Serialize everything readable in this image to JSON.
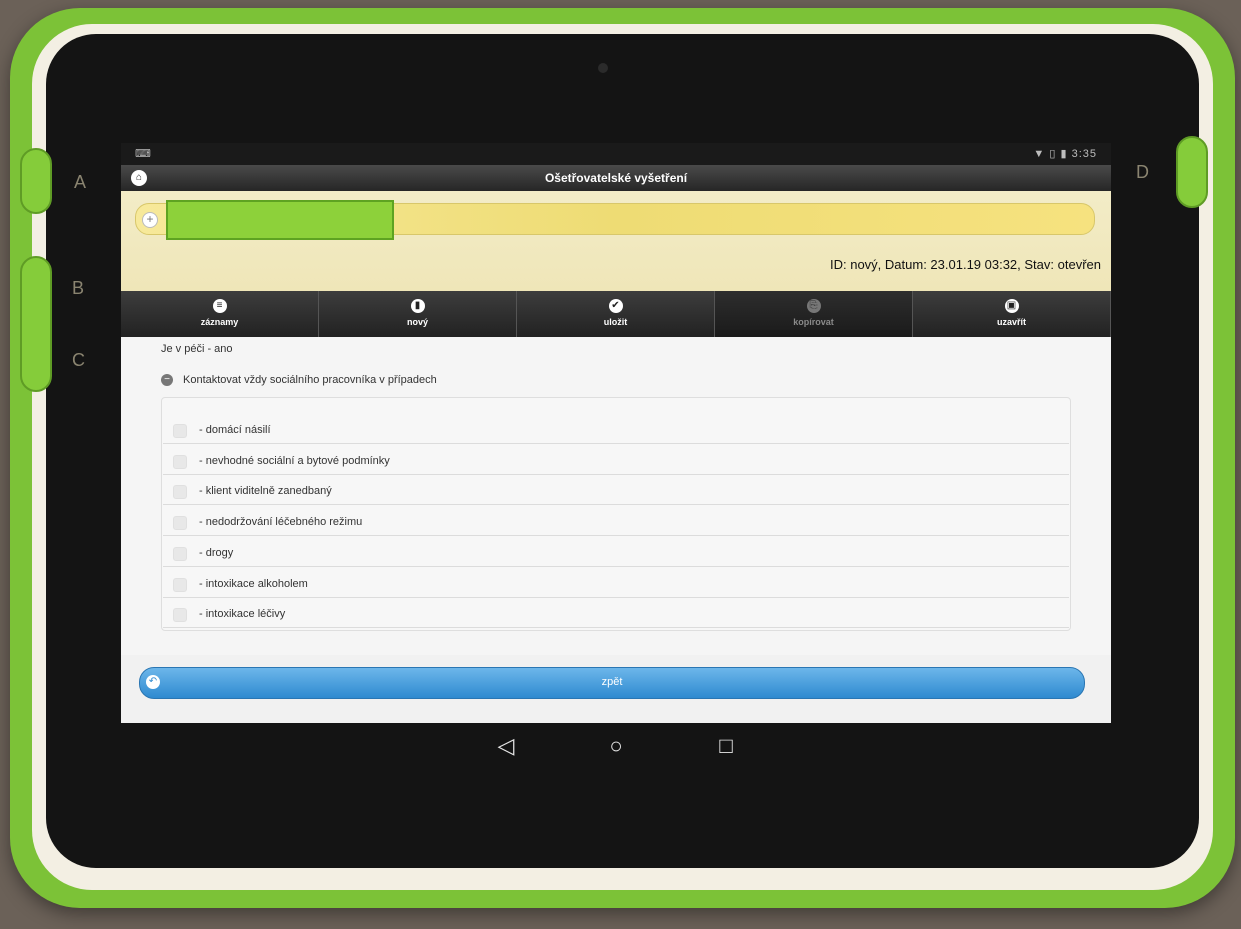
{
  "statusbar": {
    "left_icon": "keyboard-icon",
    "time": "3:35",
    "indicators": "▼ ▯ ▮"
  },
  "titlebar": {
    "title": "Ošetřovatelské vyšetření",
    "home_icon": "home-icon"
  },
  "patient": {
    "record_info": "ID: nový, Datum: 23.01.19 03:32, Stav: otevřen"
  },
  "tabs": [
    {
      "label": "záznamy",
      "icon": "list-icon",
      "glyph": "≡",
      "enabled": true
    },
    {
      "label": "nový",
      "icon": "new-document-icon",
      "glyph": "▮",
      "enabled": true
    },
    {
      "label": "uložit",
      "icon": "check-icon",
      "glyph": "✔",
      "enabled": true
    },
    {
      "label": "kopírovat",
      "icon": "copy-icon",
      "glyph": "⎘",
      "enabled": false
    },
    {
      "label": "uzavřít",
      "icon": "lock-icon",
      "glyph": "🔒",
      "enabled": true
    }
  ],
  "content": {
    "first_item": "Je v péči - ano",
    "section": "Kontaktovat vždy sociálního pracovníka v případech",
    "items": [
      " - domácí násilí",
      " - nevhodné sociální a bytové podmínky",
      " - klient viditelně zanedbaný",
      " - nedodržování léčebného režimu",
      " - drogy",
      " - intoxikace alkoholem",
      " - intoxikace léčivy"
    ]
  },
  "back_button": {
    "label": "zpět",
    "icon": "back-icon"
  },
  "device": {
    "side_letters_left": [
      "A",
      "B",
      "C"
    ],
    "side_letter_right": "D"
  },
  "navbar": {
    "back": "◁",
    "home": "○",
    "recents": "□"
  }
}
